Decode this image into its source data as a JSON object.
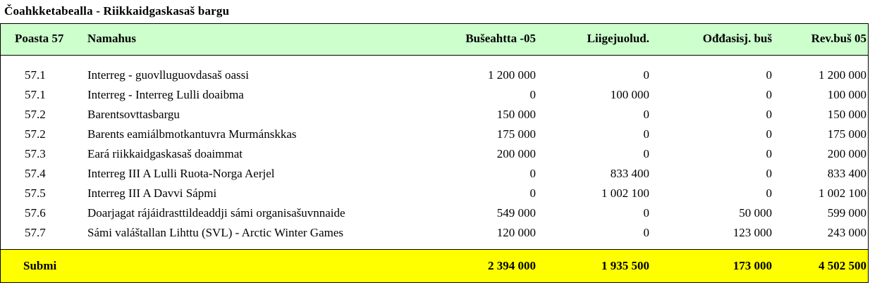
{
  "title": "Čoahkketabealla - Riikkaidgaskasaš bargu",
  "columns": {
    "poasta": "Poasta 57",
    "namahus": "Namahus",
    "buseahtta": "Bušeahtta -05",
    "liigejoolud": "Liigejuolud.",
    "oddasisj": "Ođđasisj. buš",
    "revbus": "Rev.buš 05"
  },
  "rows": [
    {
      "poasta": "57.1",
      "namahus": "Interreg - guovlluguovdasaš oassi",
      "buseahtta": "1 200 000",
      "liigejoolud": "0",
      "oddasisj": "0",
      "revbus": "1 200 000"
    },
    {
      "poasta": "57.1",
      "namahus": "Interreg - Interreg Lulli doaibma",
      "buseahtta": "0",
      "liigejoolud": "100 000",
      "oddasisj": "0",
      "revbus": "100 000"
    },
    {
      "poasta": "57.2",
      "namahus": "Barentsovttasbargu",
      "buseahtta": "150 000",
      "liigejoolud": "0",
      "oddasisj": "0",
      "revbus": "150 000"
    },
    {
      "poasta": "57.2",
      "namahus": "Barents eamiálbmotkantuvra Murmánskkas",
      "buseahtta": "175 000",
      "liigejoolud": "0",
      "oddasisj": "0",
      "revbus": "175 000"
    },
    {
      "poasta": "57.3",
      "namahus": "Eará riikkaidgaskasaš doaimmat",
      "buseahtta": "200 000",
      "liigejoolud": "0",
      "oddasisj": "0",
      "revbus": "200 000"
    },
    {
      "poasta": "57.4",
      "namahus": "Interreg III A Lulli Ruoŧa-Norga Aerjel",
      "buseahtta": "0",
      "liigejoolud": "833 400",
      "oddasisj": "0",
      "revbus": "833 400"
    },
    {
      "poasta": "57.5",
      "namahus": "Interreg III A Davvi Sápmi",
      "buseahtta": "0",
      "liigejoolud": "1 002 100",
      "oddasisj": "0",
      "revbus": "1 002 100"
    },
    {
      "poasta": "57.6",
      "namahus": "Doarjagat rájáidrasttildeaddji sámi organisašuvnnaide",
      "buseahtta": "549 000",
      "liigejoolud": "0",
      "oddasisj": "50 000",
      "revbus": "599 000"
    },
    {
      "poasta": "57.7",
      "namahus": "Sámi valáštallan Lihttu (SVL) - Arctic Winter Games",
      "buseahtta": "120 000",
      "liigejoolud": "0",
      "oddasisj": "123 000",
      "revbus": "243 000"
    }
  ],
  "footer": {
    "label": "Submi",
    "buseahtta": "2 394 000",
    "liigejoolud": "1 935 500",
    "oddasisj": "173 000",
    "revbus": "4 502 500"
  },
  "colors": {
    "header_bg": "#ccffcc",
    "footer_bg": "#ffff00"
  }
}
